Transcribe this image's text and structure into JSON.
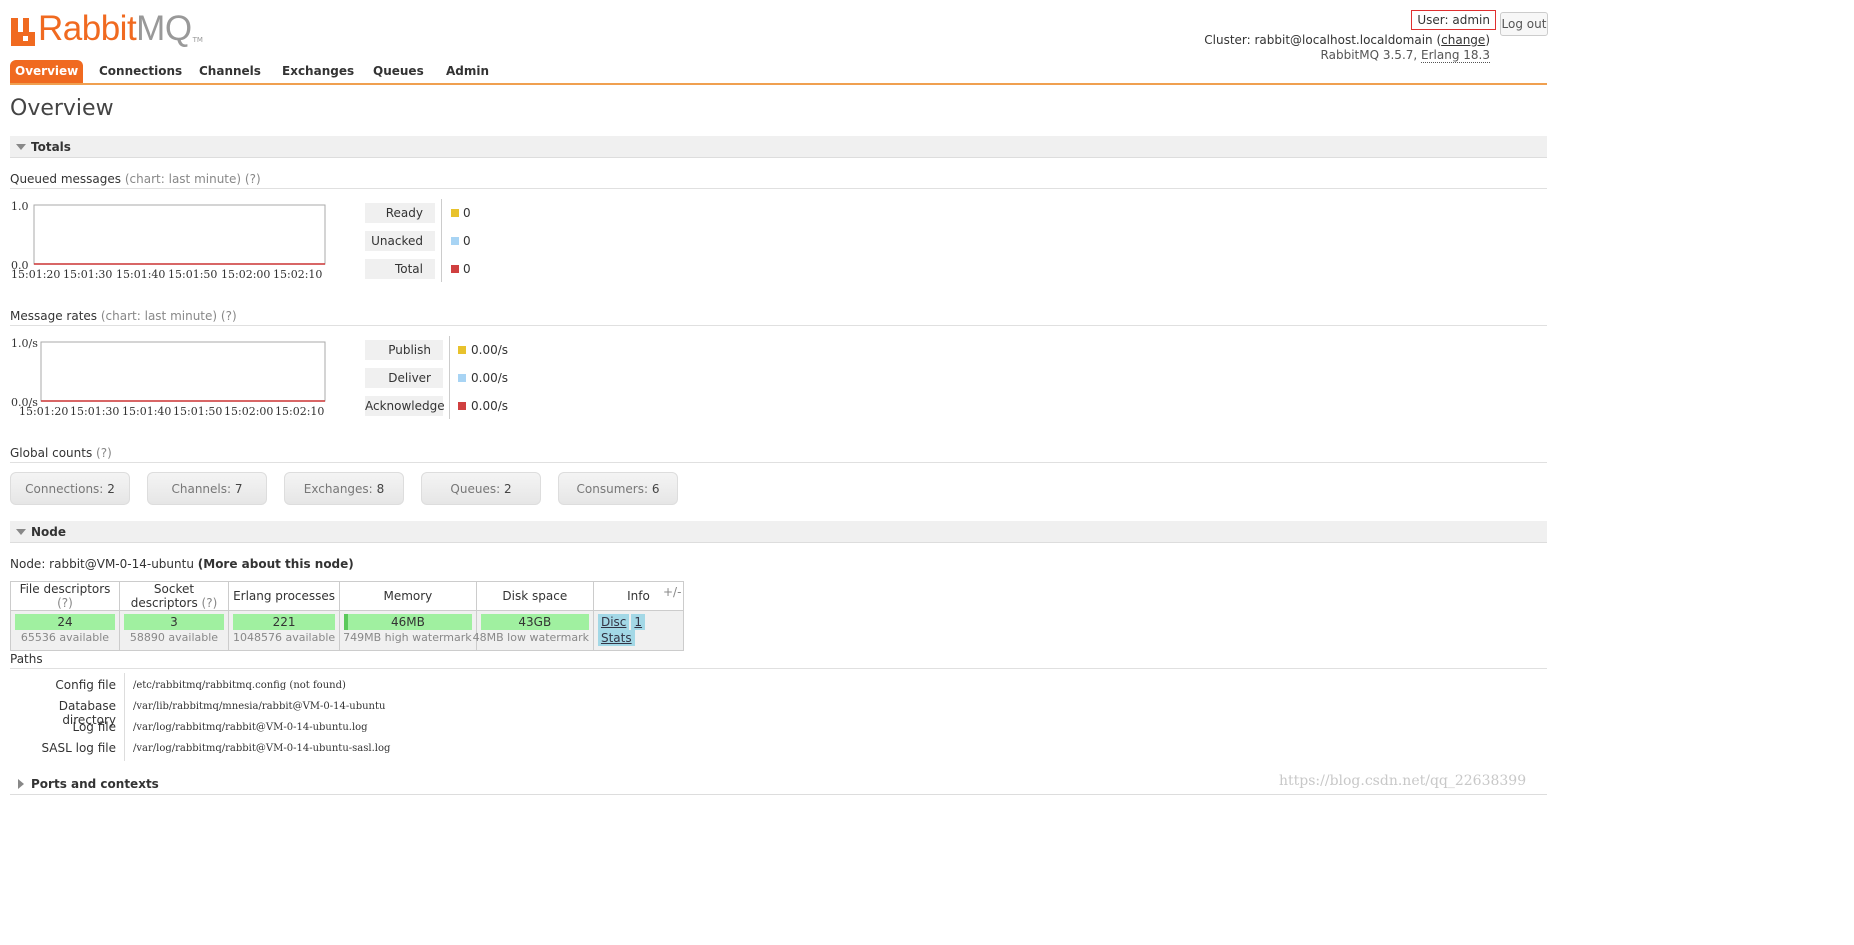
{
  "brand": {
    "name_primary": "Rabbit",
    "name_secondary": "MQ",
    "tm": "TM"
  },
  "header": {
    "user_label": "User: admin",
    "logout_label": "Log out",
    "cluster_prefix": "Cluster: rabbit@localhost.localdomain (",
    "change_label": "change",
    "cluster_suffix": ")",
    "version_prefix": "RabbitMQ 3.5.7, ",
    "erlang_label": "Erlang 18.3"
  },
  "tabs": [
    {
      "label": "Overview",
      "active": true
    },
    {
      "label": "Connections"
    },
    {
      "label": "Channels"
    },
    {
      "label": "Exchanges"
    },
    {
      "label": "Queues"
    },
    {
      "label": "Admin"
    }
  ],
  "page_title": "Overview",
  "totals": {
    "section_title": "Totals",
    "queued": {
      "title": "Queued messages",
      "note": "(chart: last minute) (?)",
      "y_top": "1.0",
      "y_bottom": "0.0",
      "x_ticks": [
        "15:01:20",
        "15:01:30",
        "15:01:40",
        "15:01:50",
        "15:02:00",
        "15:02:10"
      ],
      "legend": [
        {
          "label": "Ready",
          "value": "0",
          "color": "#e8c22c"
        },
        {
          "label": "Unacked",
          "value": "0",
          "color": "#a8d4f4"
        },
        {
          "label": "Total",
          "value": "0",
          "color": "#d04040"
        }
      ]
    },
    "rates": {
      "title": "Message rates",
      "note": "(chart: last minute) (?)",
      "y_top": "1.0/s",
      "y_bottom": "0.0/s",
      "x_ticks": [
        "15:01:20",
        "15:01:30",
        "15:01:40",
        "15:01:50",
        "15:02:00",
        "15:02:10"
      ],
      "legend": [
        {
          "label": "Publish",
          "value": "0.00/s",
          "color": "#e8c22c"
        },
        {
          "label": "Deliver",
          "value": "0.00/s",
          "color": "#a8d4f4"
        },
        {
          "label": "Acknowledge",
          "value": "0.00/s",
          "color": "#d04040"
        }
      ]
    },
    "global_counts": {
      "title": "Global counts",
      "note": "(?)",
      "items": [
        {
          "label": "Connections:",
          "value": "2"
        },
        {
          "label": "Channels:",
          "value": "7"
        },
        {
          "label": "Exchanges:",
          "value": "8"
        },
        {
          "label": "Queues:",
          "value": "2"
        },
        {
          "label": "Consumers:",
          "value": "6"
        }
      ]
    }
  },
  "node": {
    "section_title": "Node",
    "node_prefix": "Node: rabbit@VM-0-14-ubuntu ",
    "more_link": "(More about this node)",
    "columns": [
      {
        "header": "File descriptors",
        "hint": "(?)"
      },
      {
        "header": "Socket descriptors",
        "hint": "(?)"
      },
      {
        "header": "Erlang processes",
        "hint": ""
      },
      {
        "header": "Memory",
        "hint": ""
      },
      {
        "header": "Disk space",
        "hint": ""
      },
      {
        "header": "Info",
        "hint": ""
      }
    ],
    "metrics": [
      {
        "value": "24",
        "sub": "65536 available"
      },
      {
        "value": "3",
        "sub": "58890 available"
      },
      {
        "value": "221",
        "sub": "1048576 available"
      },
      {
        "value": "46MB",
        "sub": "749MB high watermark"
      },
      {
        "value": "43GB",
        "sub": "48MB low watermark"
      }
    ],
    "info_tags": [
      "Disc",
      "1",
      "Stats"
    ],
    "toggle": "+/-",
    "paths_title": "Paths",
    "paths": [
      {
        "label": "Config file",
        "value": "/etc/rabbitmq/rabbitmq.config (not found)"
      },
      {
        "label": "Database directory",
        "value": "/var/lib/rabbitmq/mnesia/rabbit@VM-0-14-ubuntu"
      },
      {
        "label": "Log file",
        "value": "/var/log/rabbitmq/rabbit@VM-0-14-ubuntu.log"
      },
      {
        "label": "SASL log file",
        "value": "/var/log/rabbitmq/rabbit@VM-0-14-ubuntu-sasl.log"
      }
    ]
  },
  "ports": {
    "section_title": "Ports and contexts"
  },
  "watermark": "https://blog.csdn.net/qq_22638399"
}
